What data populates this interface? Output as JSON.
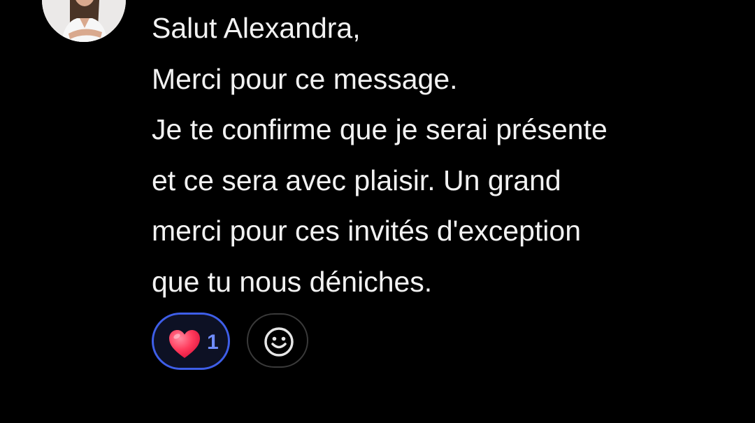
{
  "message": {
    "lines": [
      "Salut Alexandra,",
      "Merci pour ce message.",
      "Je te confirme que je serai présente",
      "et ce sera avec plaisir. Un grand",
      "merci pour ces invités d'exception",
      "que tu nous déniches."
    ]
  },
  "reactions": {
    "heart": {
      "icon": "heart-icon",
      "count": "1",
      "color": "#ff3b5c",
      "active_border": "#3e5ee8"
    },
    "add": {
      "icon": "smiley-icon"
    }
  },
  "avatar": {
    "icon": "user-avatar"
  }
}
